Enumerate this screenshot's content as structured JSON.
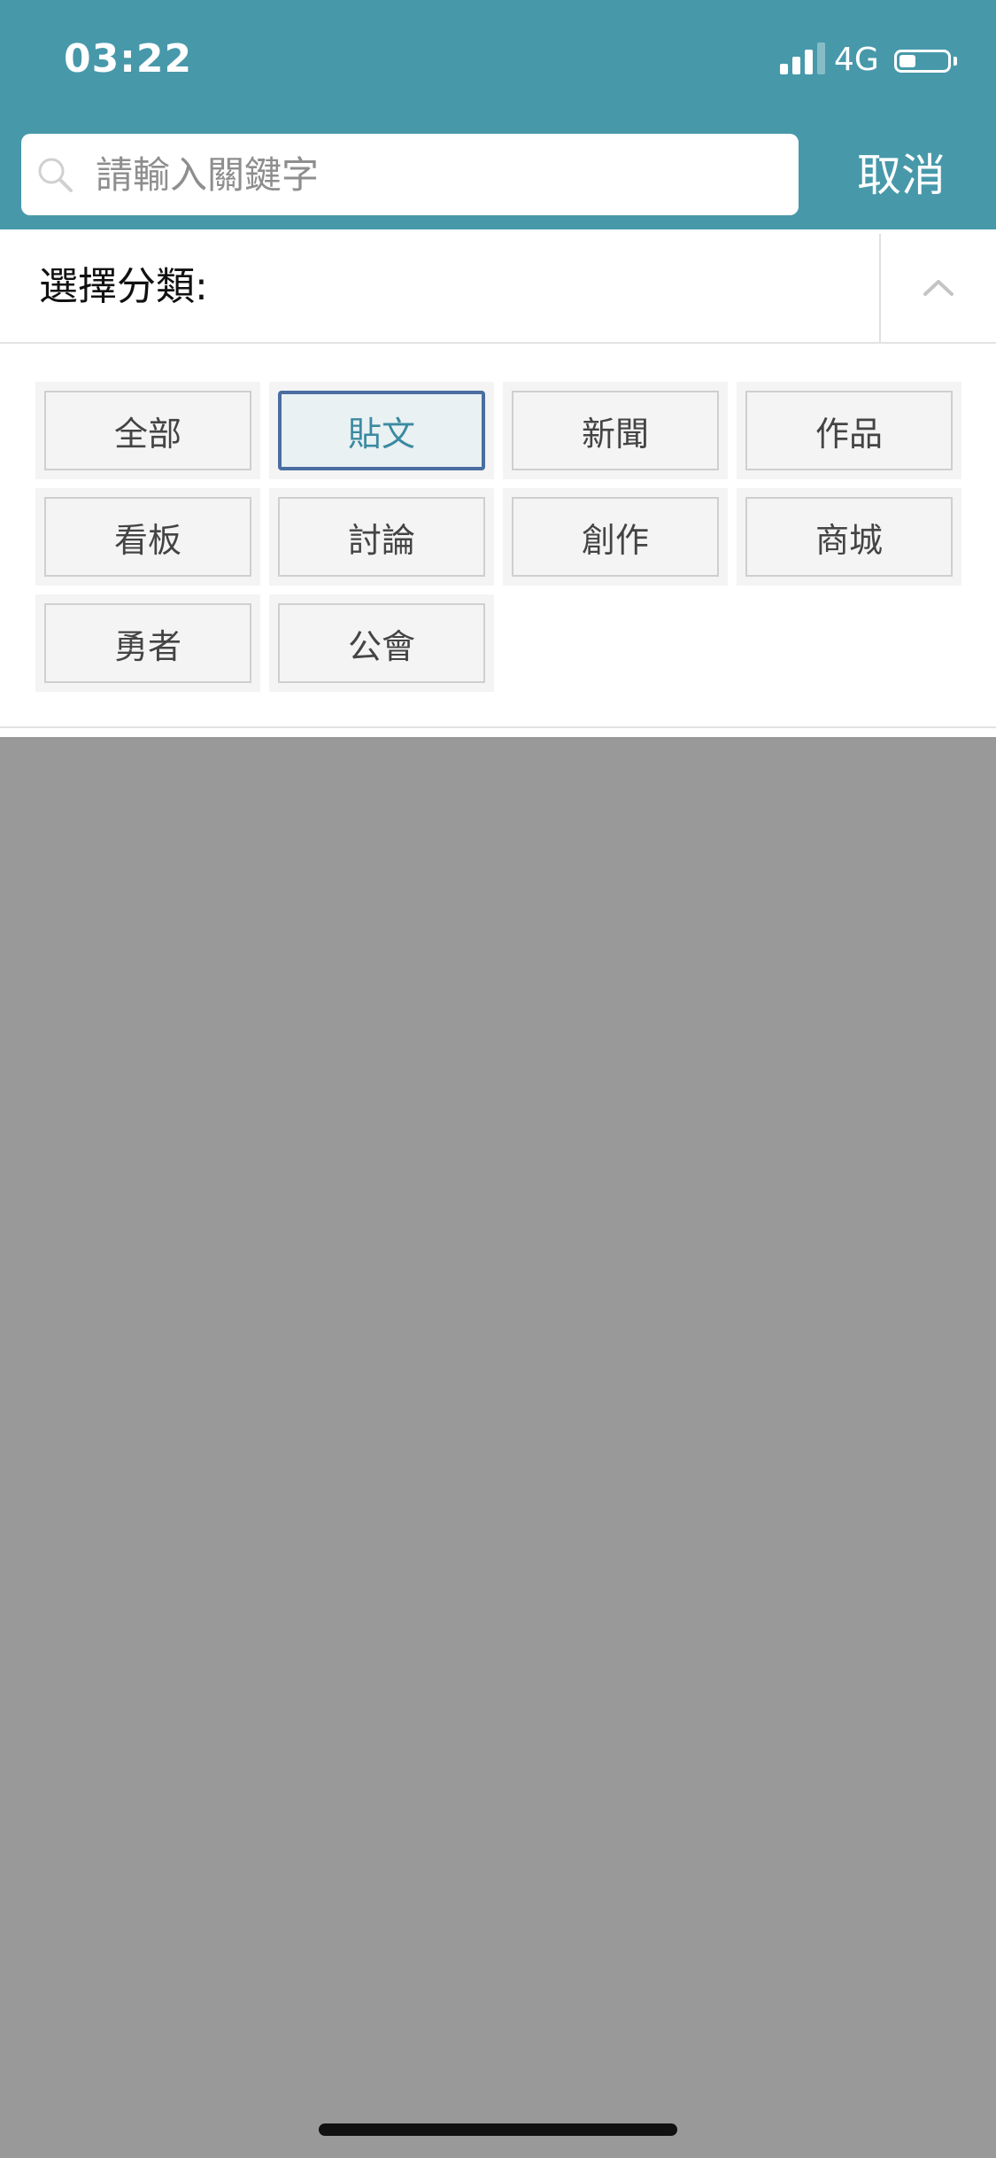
{
  "status_bar": {
    "time": "03:22",
    "network": "4G",
    "signal_bars": 3,
    "battery_level": 0.3
  },
  "search": {
    "placeholder": "請輸入關鍵字",
    "value": "",
    "cancel_label": "取消"
  },
  "category": {
    "label": "選擇分類",
    "colon": ":",
    "expanded": true,
    "options": [
      "全部",
      "貼文",
      "新聞",
      "作品",
      "看板",
      "討論",
      "創作",
      "商城",
      "勇者",
      "公會"
    ],
    "selected": "貼文"
  },
  "colors": {
    "header_bg": "#4799aa",
    "overlay": "#999999",
    "selected_border": "#4a6ea0",
    "selected_text": "#3a8aa0"
  }
}
